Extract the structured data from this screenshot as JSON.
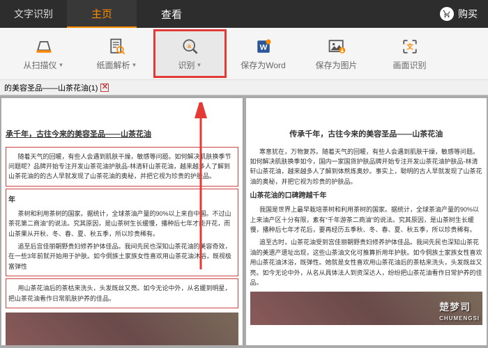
{
  "titlebar": {
    "app_name": "文字识别",
    "tabs": [
      {
        "label": "主页",
        "active": true
      },
      {
        "label": "查看",
        "active": false
      }
    ],
    "buy_label": "购买"
  },
  "toolbar": {
    "scan": {
      "label": "从扫描仪"
    },
    "parse": {
      "label": "纸面解析"
    },
    "recognize": {
      "label": "识别"
    },
    "save_word": {
      "label": "保存为Word"
    },
    "save_image": {
      "label": "保存为图片"
    },
    "screen_ocr": {
      "label": "画面识别"
    }
  },
  "doc_tab": {
    "title": "的美容圣品——山茶花油(1)"
  },
  "left_pane": {
    "title": "承千年，古往今来的美容圣品——山茶花油",
    "p1": "随着天气的回暖，有些人会遇到肌肤干燥，敏感等问题。如何解决肌肤换季节问题呢？品牌开始专注开发山茶花油护肤品-林清轩山茶花油，越来越多人了解到山茶花油的的古人早就发现了山茶花油的奥秘，并把它视为珍贵的护肤品。",
    "section1_title": "年",
    "p2": "茶树和利用茶树的国家。据统计，全球茶油产量的90%以上来自中国。不过山茶花第二商油\"的说法。究其原因，是山茶树生长缓慢，播种后七年才能开花，而山茶果从开秋、冬、春、夏、秋五季，所以珍贵稀有。",
    "p3": "追至后宫佳丽朝野贵妇修养护体佳品。我间先民也深知山茶花油的美容奇效，在一些3年前就开始用于护肤。如今侗族土家族女性喜欢用山茶花油沐浴，既视极富弹性",
    "p4": "用山茶花油后的茶枯来洗头，头发既丝又亮。如今无论中外，从名媛到明星，把山茶花油看作日常肌肤护养的佳品。"
  },
  "right_pane": {
    "title": "传承千年，古往今来的美容圣品——山茶花油",
    "p1": "寒意犹在，万物复苏。随着天气的回暖，有些人会遇到肌肤干燥，敏感等问题。如何解决肌肤换季如今，国内一家国货护肤品牌开始专注开发山茶花油护肤品-林清轩山茶花油，越来越多人了解到体熬炼奥妙。事实上，聪明的古人早就发现了山茶花油的奥秘，并把它视为珍贵的护肤品。",
    "section1_title": "山茶花油的口碑跨越千年",
    "p2": "我国是世界上最早栽培茶树和利用茶树的国家。据统计，全球茶油产量的90%以上来油产区十分有限，素有\"千年游茶二商油\"的说法。究其原因，是山茶树生长缓慢，播种后七年才花后，要再经历五季秋、冬、春、夏、秋五季，所以珍贵稀有。",
    "p3": "追至古时，山茶花油受到宫佳丽朝野贵妇修养护体佳品。我间先民也深知山茶花油的美遗产遗址出现，这些山茶油文化可推算折用年护肤。如今侗族土家族女性喜欢用山茶花油沐浴，既弹性。她就是女性喜欢用山茶花油后的茶枯来洗头，头发既丝又亮。如今无论中外，从名从具体法人到资深达人，纷纷把山茶花油看作日常护养的佳品。"
  },
  "watermark": {
    "main": "楚梦司",
    "sub": "CHUMENGSI"
  }
}
